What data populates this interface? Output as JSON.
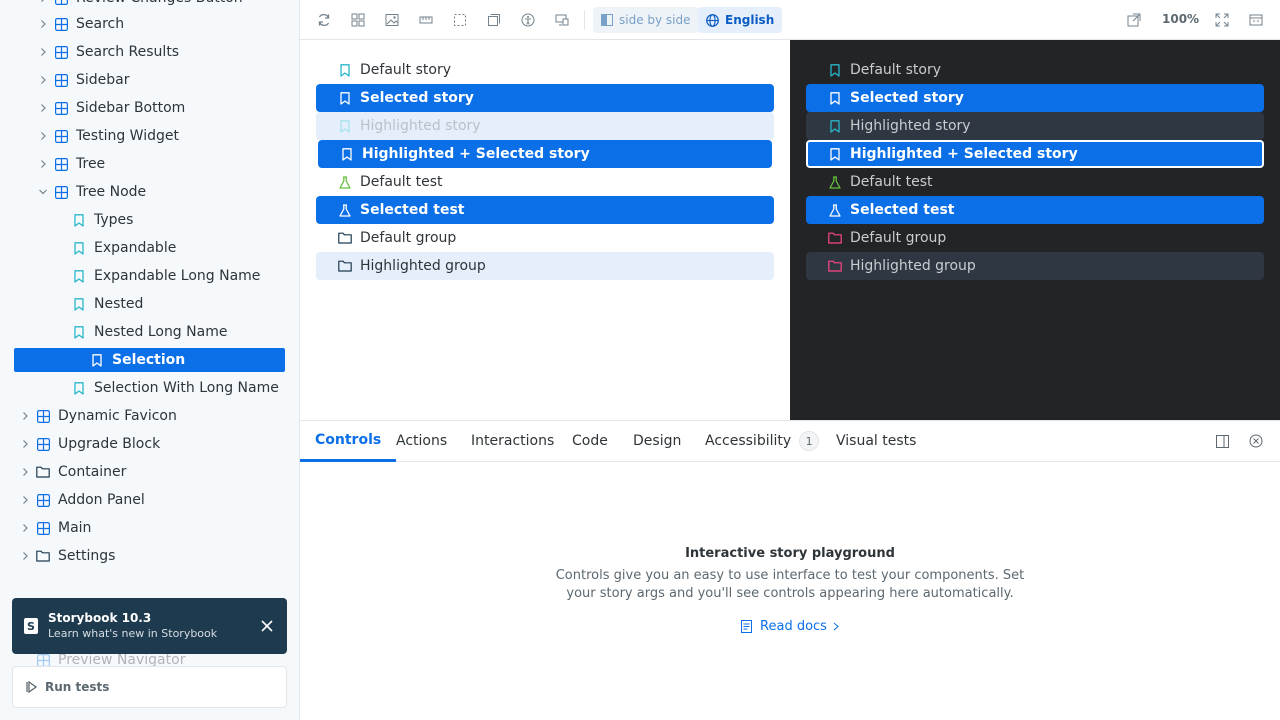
{
  "colors": {
    "accent": "#0b6fe8",
    "story_icon": "#2ab6c9",
    "test_icon": "#66bf3c",
    "group_icon_light": "#1e3a4f",
    "group_icon_dark": "#ff4785",
    "component_icon": "#0b6fe8"
  },
  "sidebar": {
    "partial_top_item": "Review Changes Button",
    "items": [
      {
        "label": "Search",
        "type": "component"
      },
      {
        "label": "Search Results",
        "type": "component"
      },
      {
        "label": "Sidebar",
        "type": "component"
      },
      {
        "label": "Sidebar Bottom",
        "type": "component"
      },
      {
        "label": "Testing Widget",
        "type": "component"
      },
      {
        "label": "Tree",
        "type": "component"
      },
      {
        "label": "Tree Node",
        "type": "component",
        "expanded": true
      },
      {
        "label": "Types",
        "type": "story"
      },
      {
        "label": "Expandable",
        "type": "story"
      },
      {
        "label": "Expandable Long Name",
        "type": "story"
      },
      {
        "label": "Nested",
        "type": "story"
      },
      {
        "label": "Nested Long Name",
        "type": "story"
      },
      {
        "label": "Selection",
        "type": "story",
        "selected": true
      },
      {
        "label": "Selection With Long Name",
        "type": "story"
      },
      {
        "label": "Dynamic Favicon",
        "type": "component"
      },
      {
        "label": "Upgrade Block",
        "type": "component"
      },
      {
        "label": "Container",
        "type": "group"
      },
      {
        "label": "Addon Panel",
        "type": "component"
      },
      {
        "label": "Main",
        "type": "component"
      },
      {
        "label": "Settings",
        "type": "group"
      }
    ],
    "hidden_items": [
      "Preview Navigator"
    ],
    "toast": {
      "title": "Storybook 10.3",
      "subtitle": "Learn what's new in Storybook"
    },
    "run_tests_label": "Run tests"
  },
  "toolbar": {
    "side_by_side_label": "side by side",
    "language_label": "English",
    "zoom_label": "100%"
  },
  "preview": {
    "light_rows": [
      {
        "label": "Default story",
        "type": "story",
        "state": "default"
      },
      {
        "label": "Selected story",
        "type": "story",
        "state": "selected"
      },
      {
        "label": "Highlighted story",
        "type": "story",
        "state": "highlighted-faded"
      },
      {
        "label": "Highlighted + Selected story",
        "type": "story",
        "state": "selected"
      },
      {
        "label": "Default test",
        "type": "test",
        "state": "default"
      },
      {
        "label": "Selected test",
        "type": "test",
        "state": "selected"
      },
      {
        "label": "Default group",
        "type": "group",
        "state": "default"
      },
      {
        "label": "Highlighted group",
        "type": "group",
        "state": "highlighted"
      }
    ],
    "dark_rows": [
      {
        "label": "Default story",
        "type": "story",
        "state": "default"
      },
      {
        "label": "Selected story",
        "type": "story",
        "state": "selected"
      },
      {
        "label": "Highlighted story",
        "type": "story",
        "state": "highlighted"
      },
      {
        "label": "Highlighted + Selected story",
        "type": "story",
        "state": "outline"
      },
      {
        "label": "Default test",
        "type": "test",
        "state": "default"
      },
      {
        "label": "Selected test",
        "type": "test",
        "state": "selected"
      },
      {
        "label": "Default group",
        "type": "group",
        "state": "default"
      },
      {
        "label": "Highlighted group",
        "type": "group",
        "state": "highlighted"
      }
    ]
  },
  "addon_panel": {
    "tabs": [
      {
        "label": "Controls",
        "active": true
      },
      {
        "label": "Actions"
      },
      {
        "label": "Interactions"
      },
      {
        "label": "Code"
      },
      {
        "label": "Design"
      },
      {
        "label": "Accessibility",
        "badge": "1"
      },
      {
        "label": "Visual tests"
      }
    ],
    "empty_title": "Interactive story playground",
    "empty_text_line1": "Controls give you an easy to use interface to test your components. Set",
    "empty_text_line2": "your story args and you'll see controls appearing here automatically.",
    "read_docs_label": "Read docs"
  }
}
